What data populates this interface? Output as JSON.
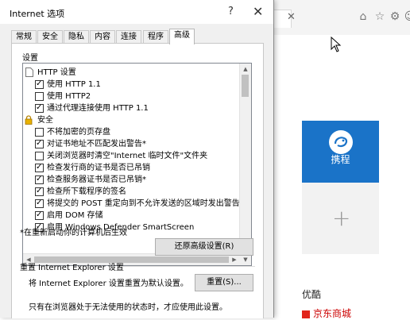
{
  "dialog": {
    "title": "Internet 选项",
    "help_glyph": "?",
    "close_glyph": "✕",
    "tabs": [
      {
        "label": "常规",
        "active": false
      },
      {
        "label": "安全",
        "active": false
      },
      {
        "label": "隐私",
        "active": false
      },
      {
        "label": "内容",
        "active": false
      },
      {
        "label": "连接",
        "active": false
      },
      {
        "label": "程序",
        "active": false
      },
      {
        "label": "高级",
        "active": true
      }
    ],
    "settings_label": "设置",
    "settings_tree": [
      {
        "type": "category",
        "icon": "page-icon",
        "label": "HTTP 设置"
      },
      {
        "type": "checkbox",
        "checked": true,
        "label": "使用 HTTP 1.1"
      },
      {
        "type": "checkbox",
        "checked": false,
        "label": "使用 HTTP2"
      },
      {
        "type": "checkbox",
        "checked": true,
        "label": "通过代理连接使用 HTTP 1.1"
      },
      {
        "type": "category",
        "icon": "lock-icon",
        "label": "安全"
      },
      {
        "type": "checkbox",
        "checked": false,
        "label": "不将加密的页存盘"
      },
      {
        "type": "checkbox",
        "checked": true,
        "label": "对证书地址不匹配发出警告*"
      },
      {
        "type": "checkbox",
        "checked": false,
        "label": "关闭浏览器时清空\"Internet 临时文件\"文件夹"
      },
      {
        "type": "checkbox",
        "checked": true,
        "label": "检查发行商的证书是否已吊销"
      },
      {
        "type": "checkbox",
        "checked": true,
        "label": "检查服务器证书是否已吊销*"
      },
      {
        "type": "checkbox",
        "checked": true,
        "label": "检查所下载程序的签名"
      },
      {
        "type": "checkbox",
        "checked": true,
        "label": "将提交的 POST 重定向到不允许发送的区域时发出警告"
      },
      {
        "type": "checkbox",
        "checked": true,
        "label": "启用 DOM 存储"
      },
      {
        "type": "checkbox",
        "checked": true,
        "label": "启用 Windows Defender SmartScreen"
      }
    ],
    "restart_note": "*在重新启动你的计算机后生效",
    "restore_button": "还原高级设置(R)",
    "reset_section_title": "重置 Internet Explorer 设置",
    "reset_description": "将 Internet Explorer 设置重置为默认设置。",
    "reset_button": "重置(S)...",
    "reset_note": "只有在浏览器处于无法使用的状态时，才应使用此设置。"
  },
  "browser": {
    "tab_close": "✕",
    "toolbar_icons": [
      "home-icon",
      "star-icon",
      "gear-icon",
      "smiley-icon"
    ],
    "tiles": [
      {
        "label": "携程",
        "color": "#1a73c8"
      },
      {
        "label": "+",
        "color": "#f2f2f2"
      }
    ],
    "favorites_title": "优酷",
    "favorites_item": "京东商城"
  }
}
